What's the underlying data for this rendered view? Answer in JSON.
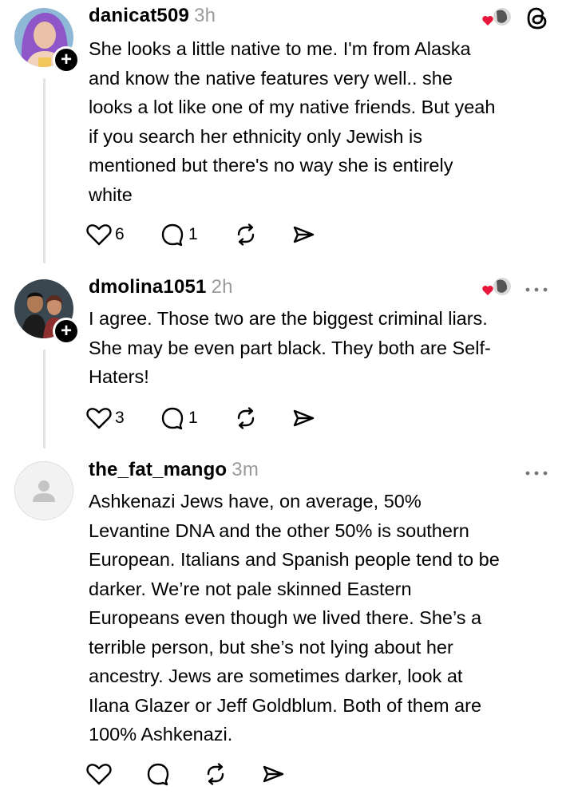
{
  "colors": {
    "text": "#000000",
    "secondary": "#9a9a9a",
    "heart": "#e8163a",
    "thread_line": "#e3e3e3"
  },
  "posts": [
    {
      "username": "danicat509",
      "time": "3h",
      "text": "She looks a little native to me. I'm from Alaska\nand know the native features very well.. she\nlooks a lot like one of my native friends. But yeah\nif you search her ethnicity only Jewish is\nmentioned but there's no way she is entirely\nwhite",
      "likes": "6",
      "replies": "1",
      "top_right_icon": "threads-logo-icon"
    },
    {
      "username": "dmolina1051",
      "time": "2h",
      "text": "I agree. Those two are the biggest criminal liars.\nShe may be even part black. They both are Self-\nHaters!",
      "likes": "3",
      "replies": "1",
      "top_right_icon": "more-icon"
    },
    {
      "username": "the_fat_mango",
      "time": "3m",
      "text": "Ashkenazi Jews have, on average, 50%\nLevantine DNA and the other 50% is southern\nEuropean. Italians and Spanish people tend to be\ndarker. We’re not pale skinned Eastern\nEuropeans even though we lived there. She’s a\nterrible person, but she’s not lying about her\nancestry. Jews are sometimes darker, look at\nIlana Glazer or Jeff Goldblum. Both of them are\n100% Ashkenazi.",
      "likes": "",
      "replies": "",
      "top_right_icon": "more-icon"
    }
  ]
}
